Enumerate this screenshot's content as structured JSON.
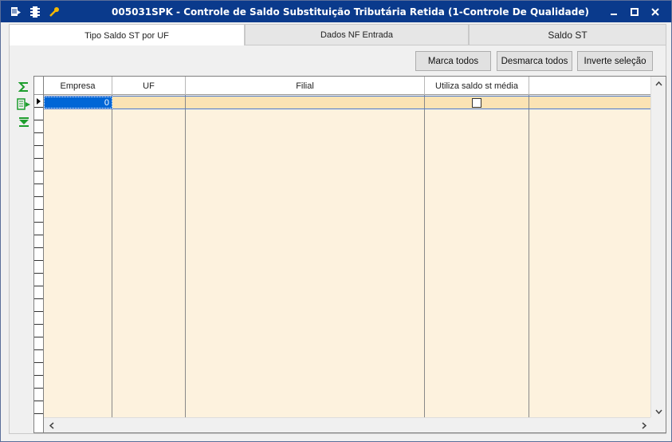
{
  "window": {
    "title": "005031SPK - Controle de Saldo Substituição Tributária Retida (1-Controle De Qualidade)"
  },
  "tabs": [
    {
      "label": "Tipo Saldo ST por UF",
      "active": true
    },
    {
      "label": "Dados NF Entrada",
      "active": false
    },
    {
      "label": "Saldo ST",
      "active": false
    }
  ],
  "toolbar": {
    "mark_all": "Marca todos",
    "unmark_all": "Desmarca todos",
    "invert": "Inverte seleção"
  },
  "grid": {
    "columns": [
      "Empresa",
      "UF",
      "Filial",
      "Utiliza saldo st média",
      ""
    ],
    "rows": [
      {
        "empresa": "0",
        "uf": "",
        "filial": "",
        "utiliza_saldo_st_media": false
      }
    ]
  },
  "colors": {
    "titlebar": "#0a3a8c",
    "grid_bg": "#fdf2de",
    "row_selected": "#fbe3b4",
    "cell_selected": "#0066d6"
  }
}
